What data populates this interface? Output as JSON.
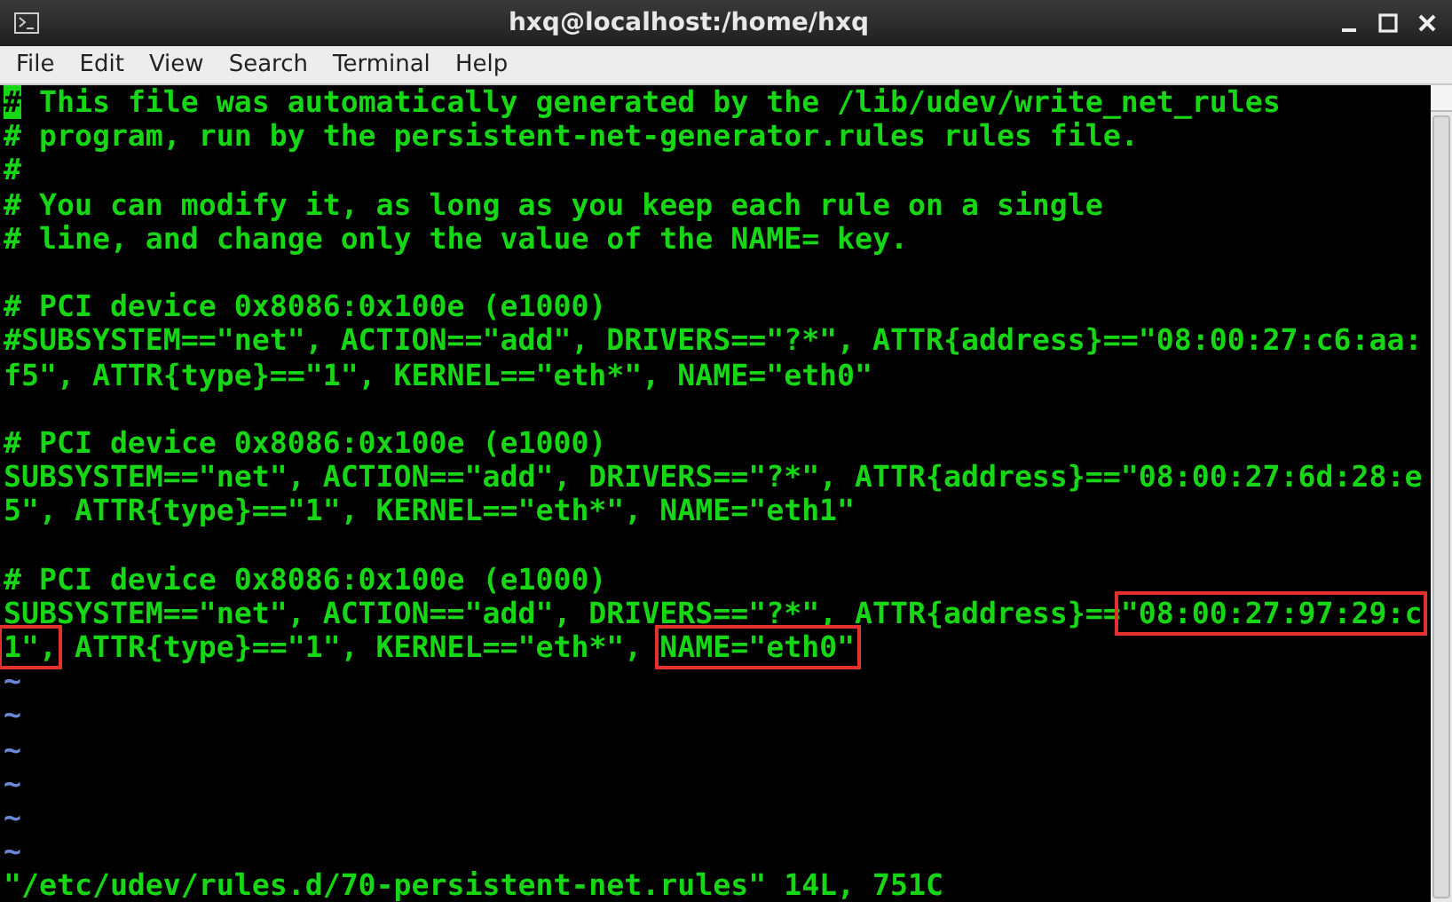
{
  "window": {
    "title": "hxq@localhost:/home/hxq"
  },
  "menu": [
    "File",
    "Edit",
    "View",
    "Search",
    "Terminal",
    "Help"
  ],
  "lines": [
    {
      "kind": "text",
      "segments": [
        {
          "kind": "cursor",
          "text": "#"
        },
        {
          "kind": "text",
          "text": " This file was automatically generated by the /lib/udev/write_net_rules"
        }
      ]
    },
    {
      "kind": "text",
      "segments": [
        {
          "kind": "text",
          "text": "# program, run by the persistent-net-generator.rules rules file."
        }
      ]
    },
    {
      "kind": "text",
      "segments": [
        {
          "kind": "text",
          "text": "#"
        }
      ]
    },
    {
      "kind": "text",
      "segments": [
        {
          "kind": "text",
          "text": "# You can modify it, as long as you keep each rule on a single"
        }
      ]
    },
    {
      "kind": "text",
      "segments": [
        {
          "kind": "text",
          "text": "# line, and change only the value of the NAME= key."
        }
      ]
    },
    {
      "kind": "blank"
    },
    {
      "kind": "text",
      "segments": [
        {
          "kind": "text",
          "text": "# PCI device 0x8086:0x100e (e1000)"
        }
      ]
    },
    {
      "kind": "text",
      "segments": [
        {
          "kind": "text",
          "text": "#SUBSYSTEM==\"net\", ACTION==\"add\", DRIVERS==\"?*\", ATTR{address}==\"08:00:27:c6:aa:"
        }
      ]
    },
    {
      "kind": "text",
      "segments": [
        {
          "kind": "text",
          "text": "f5\", ATTR{type}==\"1\", KERNEL==\"eth*\", NAME=\"eth0\""
        }
      ]
    },
    {
      "kind": "blank"
    },
    {
      "kind": "text",
      "segments": [
        {
          "kind": "text",
          "text": "# PCI device 0x8086:0x100e (e1000)"
        }
      ]
    },
    {
      "kind": "text",
      "segments": [
        {
          "kind": "text",
          "text": "SUBSYSTEM==\"net\", ACTION==\"add\", DRIVERS==\"?*\", ATTR{address}==\"08:00:27:6d:28:e"
        }
      ]
    },
    {
      "kind": "text",
      "segments": [
        {
          "kind": "text",
          "text": "5\", ATTR{type}==\"1\", KERNEL==\"eth*\", NAME=\"eth1\""
        }
      ]
    },
    {
      "kind": "blank"
    },
    {
      "kind": "text",
      "segments": [
        {
          "kind": "text",
          "text": "# PCI device 0x8086:0x100e (e1000)"
        }
      ]
    },
    {
      "kind": "text",
      "segments": [
        {
          "kind": "text",
          "text": "SUBSYSTEM==\"net\", ACTION==\"add\", DRIVERS==\"?*\", ATTR{address}=="
        },
        {
          "kind": "highlight",
          "text": "\"08:00:27:97:29:c"
        }
      ]
    },
    {
      "kind": "text",
      "segments": [
        {
          "kind": "highlight",
          "text": "1\","
        },
        {
          "kind": "text",
          "text": " ATTR{type}==\"1\", KERNEL==\"eth*\", "
        },
        {
          "kind": "highlight",
          "text": "NAME=\"eth0\""
        }
      ]
    },
    {
      "kind": "tilde",
      "segments": [
        {
          "kind": "text",
          "text": "~"
        }
      ]
    },
    {
      "kind": "tilde",
      "segments": [
        {
          "kind": "text",
          "text": "~"
        }
      ]
    },
    {
      "kind": "tilde",
      "segments": [
        {
          "kind": "text",
          "text": "~"
        }
      ]
    },
    {
      "kind": "tilde",
      "segments": [
        {
          "kind": "text",
          "text": "~"
        }
      ]
    },
    {
      "kind": "tilde",
      "segments": [
        {
          "kind": "text",
          "text": "~"
        }
      ]
    },
    {
      "kind": "tilde",
      "segments": [
        {
          "kind": "text",
          "text": "~"
        }
      ]
    }
  ],
  "status_line": "\"/etc/udev/rules.d/70-persistent-net.rules\" 14L, 751C"
}
